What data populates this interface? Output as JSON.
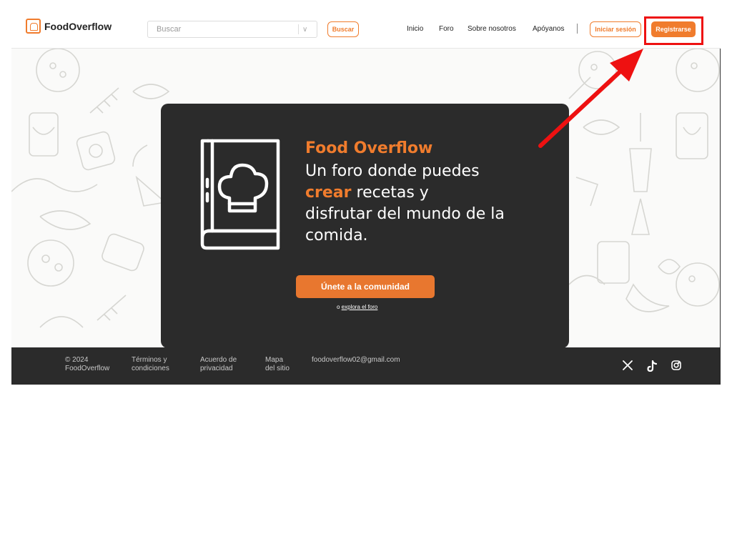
{
  "header": {
    "logo_text": "FoodOverflow",
    "search_placeholder": "Buscar",
    "search_caret": "∨",
    "search_button": "Buscar",
    "nav": [
      "Inicio",
      "Foro",
      "Sobre nosotros",
      "Apóyanos"
    ],
    "login_button": "Iniciar sesión",
    "register_button": "Registrarse"
  },
  "hero": {
    "title": "Food Overflow",
    "line_1": "Un foro donde puedes",
    "accent_word": "crear",
    "line_2_rest": " recetas y",
    "line_3": "disfrutar del mundo de la comida.",
    "cta_button": "Únete a la comunidad",
    "explore_prefix": "o ",
    "explore_link": "explora el foro"
  },
  "footer": {
    "copyright": [
      "© 2024",
      "FoodOverflow"
    ],
    "terms": [
      "Términos y",
      "condiciones"
    ],
    "privacy": [
      "Acuerdo de",
      "privacidad"
    ],
    "sitemap": [
      "Mapa",
      "del sitio"
    ],
    "email": "foodoverflow02@gmail.com",
    "social_icons": [
      "x-icon",
      "tiktok-icon",
      "instagram-icon"
    ]
  },
  "colors": {
    "accent": "#f07c2d",
    "card": "#2b2b2b",
    "footer": "#2b2b2b",
    "annotation": "#ee1111"
  }
}
